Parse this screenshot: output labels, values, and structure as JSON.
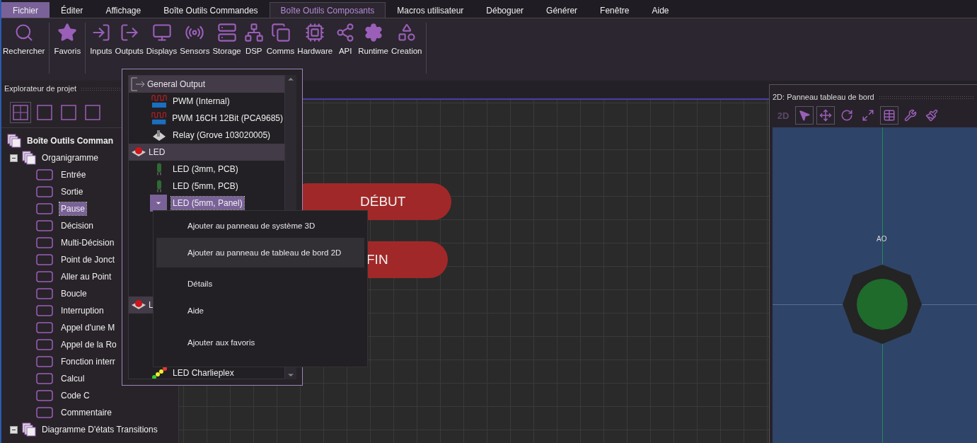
{
  "menu": [
    {
      "label": "Fichier",
      "kind": "file",
      "selected": false
    },
    {
      "label": "Éditer",
      "kind": "tab",
      "selected": false
    },
    {
      "label": "Affichage",
      "kind": "tab",
      "selected": false
    },
    {
      "label": "Boîte Outils Commandes",
      "kind": "tab",
      "selected": false
    },
    {
      "label": "Boîte Outils Composants",
      "kind": "tab",
      "selected": true
    },
    {
      "label": "Macros utilisateur",
      "kind": "tab",
      "selected": false
    },
    {
      "label": "Déboguer",
      "kind": "tab",
      "selected": false
    },
    {
      "label": "Générer",
      "kind": "tab",
      "selected": false
    },
    {
      "label": "Fenêtre",
      "kind": "tab",
      "selected": false
    },
    {
      "label": "Aide",
      "kind": "tab",
      "selected": false
    }
  ],
  "ribbon": [
    {
      "label": "Rechercher"
    },
    {
      "label": "Favoris"
    },
    {
      "label": "Inputs"
    },
    {
      "label": "Outputs"
    },
    {
      "label": "Displays"
    },
    {
      "label": "Sensors"
    },
    {
      "label": "Storage"
    },
    {
      "label": "DSP"
    },
    {
      "label": "Comms"
    },
    {
      "label": "Hardware"
    },
    {
      "label": "API"
    },
    {
      "label": "Runtime"
    },
    {
      "label": "Creation"
    }
  ],
  "project_explorer": {
    "title": "Explorateur de projet",
    "views": [
      {
        "selected": true
      },
      {
        "selected": false
      },
      {
        "selected": false
      },
      {
        "selected": false
      }
    ],
    "tree": [
      {
        "label": "Boîte Outils Comman",
        "children": [
          {
            "label": "Organigramme",
            "expanded": true,
            "children": [
              {
                "label": "Entrée",
                "selected": false
              },
              {
                "label": "Sortie",
                "selected": false
              },
              {
                "label": "Pause",
                "selected": true
              },
              {
                "label": "Décision",
                "selected": false
              },
              {
                "label": "Multi-Décision",
                "selected": false
              },
              {
                "label": "Point de Jonct",
                "selected": false
              },
              {
                "label": "Aller au Point",
                "selected": false
              },
              {
                "label": "Boucle",
                "selected": false
              },
              {
                "label": "Interruption",
                "selected": false
              },
              {
                "label": "Appel d'une M",
                "selected": false
              },
              {
                "label": "Appel de la Ro",
                "selected": false
              },
              {
                "label": "Fonction interr",
                "selected": false
              },
              {
                "label": "Calcul",
                "selected": false
              },
              {
                "label": "Code C",
                "selected": false
              },
              {
                "label": "Commentaire",
                "selected": false
              }
            ]
          },
          {
            "label": "Diagramme D'états Transitions",
            "expanded": true
          }
        ]
      }
    ]
  },
  "component_popup": {
    "groups": [
      {
        "label": "General Output",
        "items": [
          {
            "label": "PWM (Internal)",
            "selected": false
          },
          {
            "label": "PWM 16CH 12Bit (PCA9685)",
            "selected": false
          },
          {
            "label": "Relay (Grove 103020005)",
            "selected": false
          }
        ]
      },
      {
        "label": "LED",
        "items": [
          {
            "label": "LED (3mm, PCB)",
            "selected": false
          },
          {
            "label": "LED (5mm, PCB)",
            "selected": false
          },
          {
            "label": "LED (5mm, Panel)",
            "selected": true
          }
        ]
      },
      {
        "label": "L",
        "items": [
          {
            "label": "LED Charlieplex",
            "selected": false
          }
        ]
      }
    ]
  },
  "context_menu": [
    {
      "label": "Ajouter au panneau de système 3D",
      "highlighted": false
    },
    {
      "label": "Ajouter au panneau de tableau de bord 2D",
      "highlighted": true
    },
    {
      "label": "Détails",
      "highlighted": false
    },
    {
      "label": "Aide",
      "highlighted": false
    },
    {
      "label": "Ajouter aux favoris",
      "highlighted": false
    }
  ],
  "flowchart": [
    {
      "label": "DÉBUT",
      "kind": "start"
    },
    {
      "label": "FIN",
      "kind": "end"
    }
  ],
  "dashboard": {
    "title": "2D: Panneau tableau de bord",
    "tools": [
      {
        "label": "2D",
        "disabled": true
      }
    ],
    "led_label": "AO"
  }
}
